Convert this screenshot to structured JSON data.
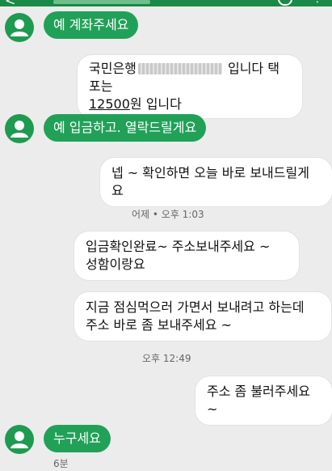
{
  "app": {
    "back_glyph": "<",
    "more_glyph": "⋮",
    "colors": {
      "appbar": "#1a8a46",
      "incoming": "#21a158",
      "outgoing": "#ffffff",
      "background": "#ececec"
    }
  },
  "messages": [
    {
      "dir": "in",
      "text": "예 계좌주세요"
    },
    {
      "dir": "out",
      "prefix": "국민은행",
      "redacted_account": true,
      "suffix": "입니다 택포는",
      "amount": "12500",
      "amount_suffix": "원 입니다"
    },
    {
      "dir": "in",
      "text": "예 입금하고. 열락드릴게요"
    },
    {
      "dir": "out",
      "text": "넵 ~ 확인하면 오늘 바로 보내드릴게요"
    },
    {
      "dir": "time",
      "text": "어제 • 오후 1:03"
    },
    {
      "dir": "out",
      "line1": "입금확인완료~ 주소보내주세요 ~",
      "line2": "성함이랑요"
    },
    {
      "dir": "out",
      "line1": "지금 점심먹으러 가면서 보내려고 하는데",
      "line2": "주소 바로 좀 보내주세요 ~"
    },
    {
      "dir": "time",
      "text": "오후 12:49"
    },
    {
      "dir": "out",
      "text": "주소 좀 불러주세요~"
    },
    {
      "dir": "in",
      "text": "누구세요"
    },
    {
      "dir": "time",
      "text": "6분"
    }
  ]
}
